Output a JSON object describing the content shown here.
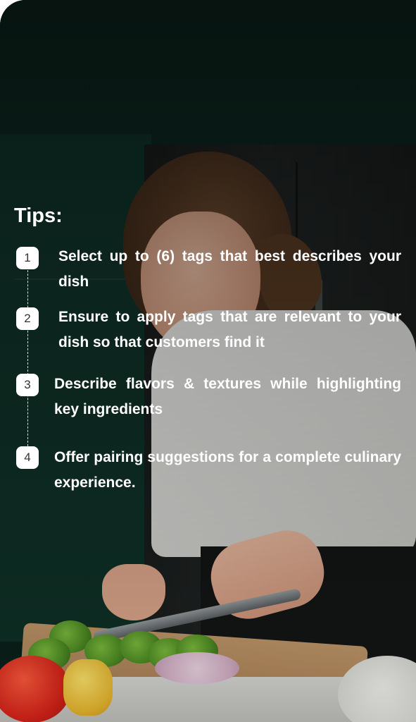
{
  "tips": {
    "title": "Tips:",
    "steps": [
      {
        "number": "1",
        "text": "Select up to (6) tags that best describes your dish"
      },
      {
        "number": "2",
        "text": "Ensure to apply tags that are relevant to your dish so that customers find it"
      },
      {
        "number": "3",
        "text": "Describe flavors & textures  while highlighting key ingredients"
      },
      {
        "number": "4",
        "text": "Offer pairing suggestions for a complete culinary experience."
      }
    ]
  }
}
